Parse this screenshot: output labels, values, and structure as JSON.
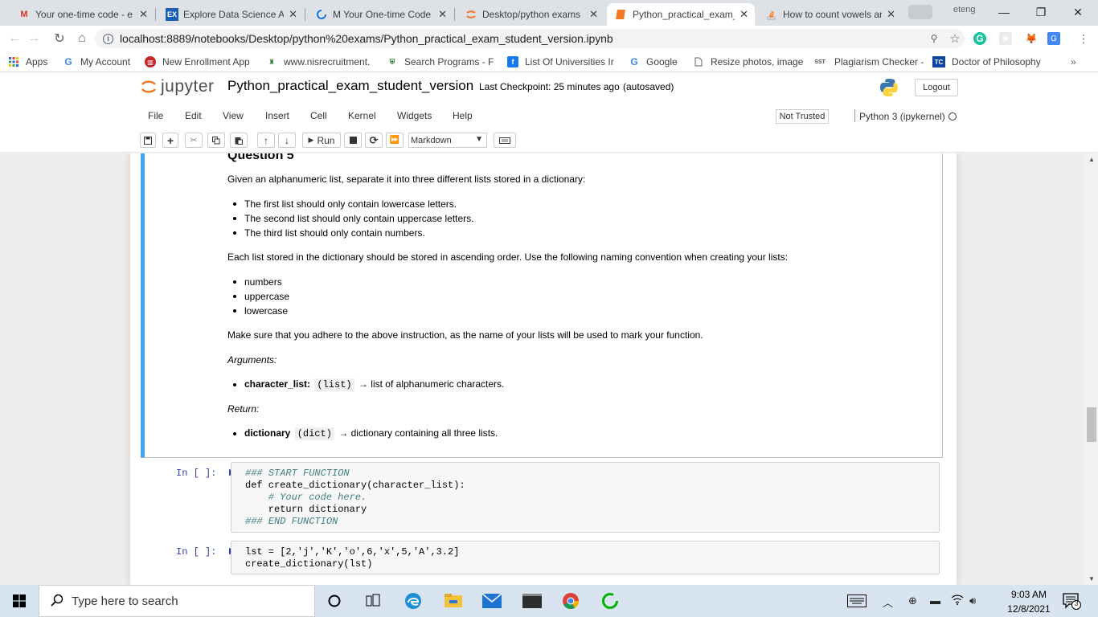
{
  "browser": {
    "tabs": [
      {
        "title": "Your one-time code - e",
        "icon": "gmail-icon",
        "active": false
      },
      {
        "title": "Explore Data Science Ac",
        "icon": "ex-icon",
        "active": false
      },
      {
        "title": "M Your One-time Code",
        "icon": "loading-icon",
        "active": false
      },
      {
        "title": "Desktop/python exams",
        "icon": "jupyter-icon",
        "active": false
      },
      {
        "title": "Python_practical_exam_",
        "icon": "notebook-icon",
        "active": true
      },
      {
        "title": "How to count vowels ar",
        "icon": "stackoverflow-icon",
        "active": false
      }
    ],
    "profile_name": "eteng",
    "url": "localhost:8889/notebooks/Desktop/python%20exams/Python_practical_exam_student_version.ipynb",
    "bookmarks": [
      {
        "label": "Apps",
        "icon": "apps-grid-icon"
      },
      {
        "label": "My Account",
        "icon": "google-icon"
      },
      {
        "label": "New Enrollment App",
        "icon": "bank-icon"
      },
      {
        "label": "www.nisrecruitment.",
        "icon": "emblem-icon"
      },
      {
        "label": "Search Programs - F",
        "icon": "university-icon"
      },
      {
        "label": "List Of Universities Ir",
        "icon": "facebook-icon"
      },
      {
        "label": "Google",
        "icon": "google-icon"
      },
      {
        "label": "Resize photos, image",
        "icon": "page-icon"
      },
      {
        "label": "Plagiarism Checker -",
        "icon": "sst-icon"
      },
      {
        "label": "Doctor of Philosophy",
        "icon": "tc-icon"
      }
    ],
    "sst_label": "SST",
    "tc_label": "TC"
  },
  "jupyter": {
    "logo_text": "jupyter",
    "notebook_name": "Python_practical_exam_student_version",
    "checkpoint": "Last Checkpoint: 25 minutes ago",
    "autosave": "(autosaved)",
    "logout_label": "Logout",
    "menu": [
      "File",
      "Edit",
      "View",
      "Insert",
      "Cell",
      "Kernel",
      "Widgets",
      "Help"
    ],
    "trust_label": "Not Trusted",
    "kernel_name": "Python 3 (ipykernel)",
    "run_label": "Run",
    "cell_type": "Markdown"
  },
  "markdown": {
    "heading": "Question 5",
    "intro": "Given an alphanumeric list, separate it into three different lists stored in a dictionary:",
    "rules": [
      "The first list should only contain lowercase letters.",
      "The second list should only contain uppercase letters.",
      "The third list should only contain numbers."
    ],
    "order_text": "Each list stored in the dictionary should be stored in ascending order. Use the following naming convention when creating your lists:",
    "names": [
      "numbers",
      "uppercase",
      "lowercase"
    ],
    "adhere_text": "Make sure that you adhere to the above instruction, as the name of your lists will be used to mark your function.",
    "arguments_label": "Arguments:",
    "arg_name": "character_list:",
    "arg_type": "(list)",
    "arg_arrow": "→",
    "arg_desc": "list of alphanumeric characters.",
    "return_label": "Return:",
    "ret_name": "dictionary",
    "ret_type": "(dict)",
    "ret_arrow": "→",
    "ret_desc": "dictionary containing all three lists."
  },
  "code_cells": [
    {
      "prompt": "In [ ]:",
      "lines": [
        "### START FUNCTION",
        "def create_dictionary(character_list):",
        "    # Your code here.",
        "    return dictionary",
        "### END FUNCTION"
      ]
    },
    {
      "prompt": "In [ ]:",
      "lines": [
        "lst = [2,'j','K','o',6,'x',5,'A',3.2]",
        "create_dictionary(lst)"
      ]
    }
  ],
  "taskbar": {
    "search_placeholder": "Type here to search",
    "time": "9:03 AM",
    "date": "12/8/2021",
    "notification_count": "3"
  },
  "colors": {
    "cell_selected": "#42a5f5",
    "prompt_blue": "#303f9f",
    "taskbar": "#d9e4f1"
  }
}
